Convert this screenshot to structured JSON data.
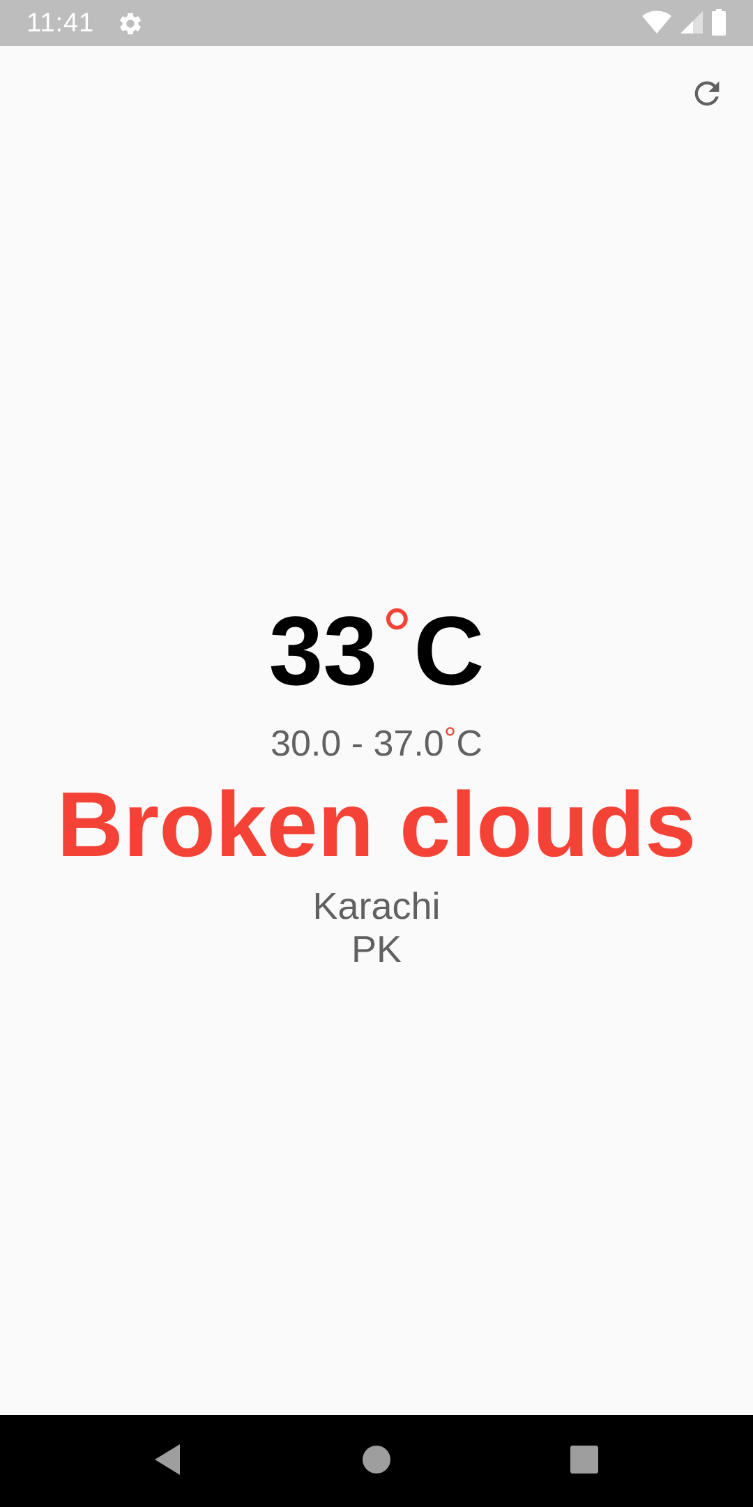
{
  "status_bar": {
    "time": "11:41",
    "icons": [
      "settings-icon",
      "wifi-icon",
      "signal-icon",
      "battery-icon"
    ],
    "background": "#bdbdbd"
  },
  "toolbar": {
    "refresh_icon": "refresh-icon"
  },
  "weather": {
    "temperature": "33",
    "degree_symbol": "°",
    "unit": "C",
    "range_text": "30.0 - 37.0",
    "range_degree": "°",
    "range_unit": "C",
    "condition": "Broken clouds",
    "city": "Karachi",
    "country": "PK"
  },
  "nav_bar": {
    "buttons": [
      "back-icon",
      "home-icon",
      "recents-icon"
    ]
  },
  "colors": {
    "accent": "#f44336",
    "primary_text": "#000000",
    "secondary_text": "#616161",
    "background": "#fafafa"
  }
}
